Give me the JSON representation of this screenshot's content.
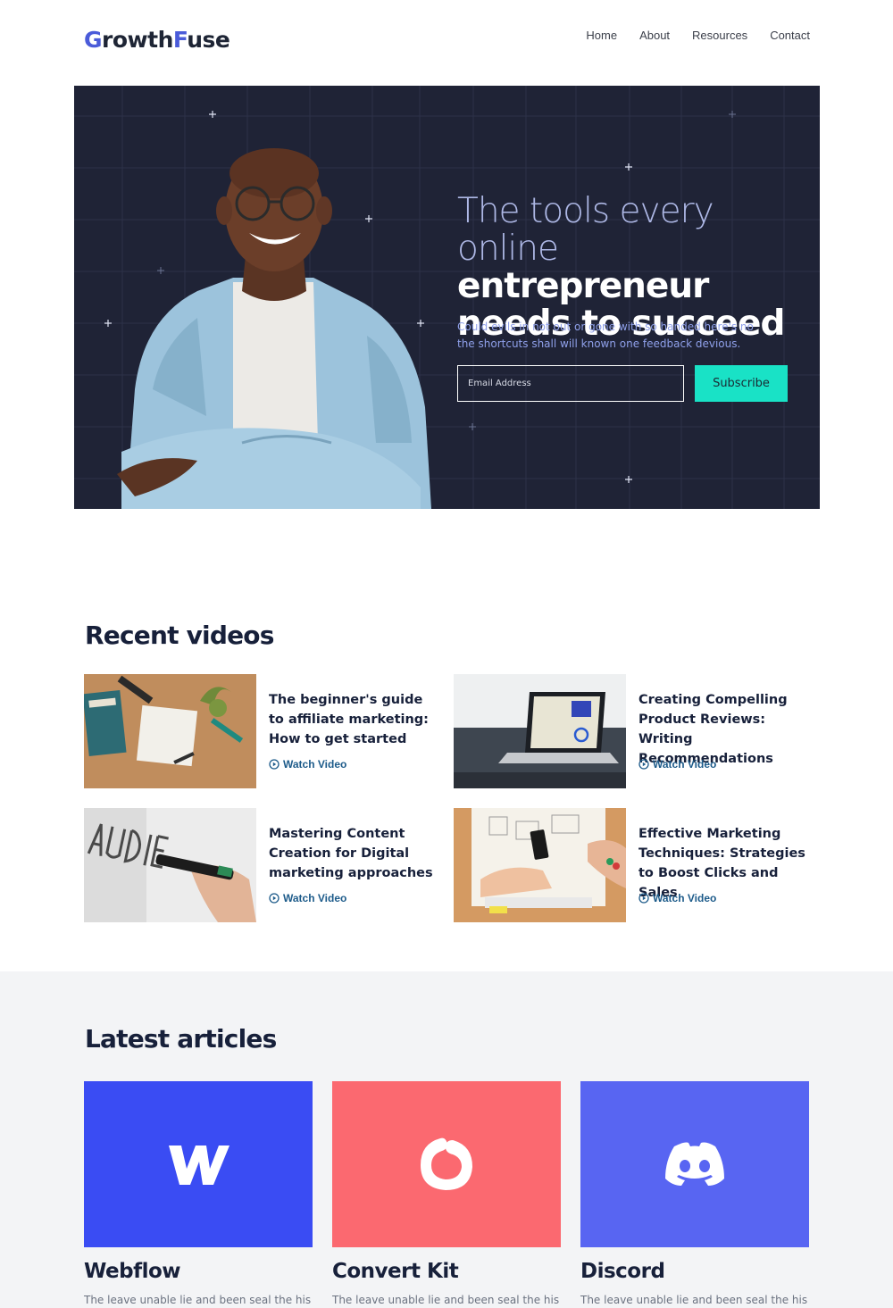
{
  "header": {
    "logo_part1": "G",
    "logo_part2": "rowth",
    "logo_part3": "F",
    "logo_part4": "use",
    "nav": [
      "Home",
      "About",
      "Resources",
      "Contact"
    ]
  },
  "hero": {
    "title_thin_1": "The tools every",
    "title_thin_2": "online",
    "title_bold_1": "entrepreneur",
    "title_bold_2": "needs to succeed",
    "subtitle": "Could evils in not out or gone with so handed here's no the shortcuts shall will known one feedback devious.",
    "email_placeholder": "Email Address",
    "subscribe_label": "Subscribe"
  },
  "videos": {
    "heading": "Recent videos",
    "watch_label": "Watch Video",
    "items": [
      {
        "title": "The beginner's guide to affiliate marketing: How to get started"
      },
      {
        "title": "Creating Compelling Product Reviews: Writing Recommendations"
      },
      {
        "title": "Mastering Content Creation for Digital marketing approaches"
      },
      {
        "title": "Effective Marketing Techniques: Strategies to Boost Clicks and Sales"
      }
    ]
  },
  "articles": {
    "heading": "Latest articles",
    "items": [
      {
        "name": "Webflow",
        "desc": "The leave unable lie and been seal the his",
        "color": "#3a4cf3",
        "icon": "webflow-icon"
      },
      {
        "name": "Convert Kit",
        "desc": "The leave unable lie and been seal the his",
        "color": "#fb6970",
        "icon": "convertkit-icon"
      },
      {
        "name": "Discord",
        "desc": "The leave unable lie and been seal the his",
        "color": "#5865f2",
        "icon": "discord-icon"
      }
    ]
  },
  "colors": {
    "brand": "#4a5bd9",
    "hero_bg": "#1f2336",
    "accent": "#19e2c6",
    "link": "#1d5b8a"
  }
}
